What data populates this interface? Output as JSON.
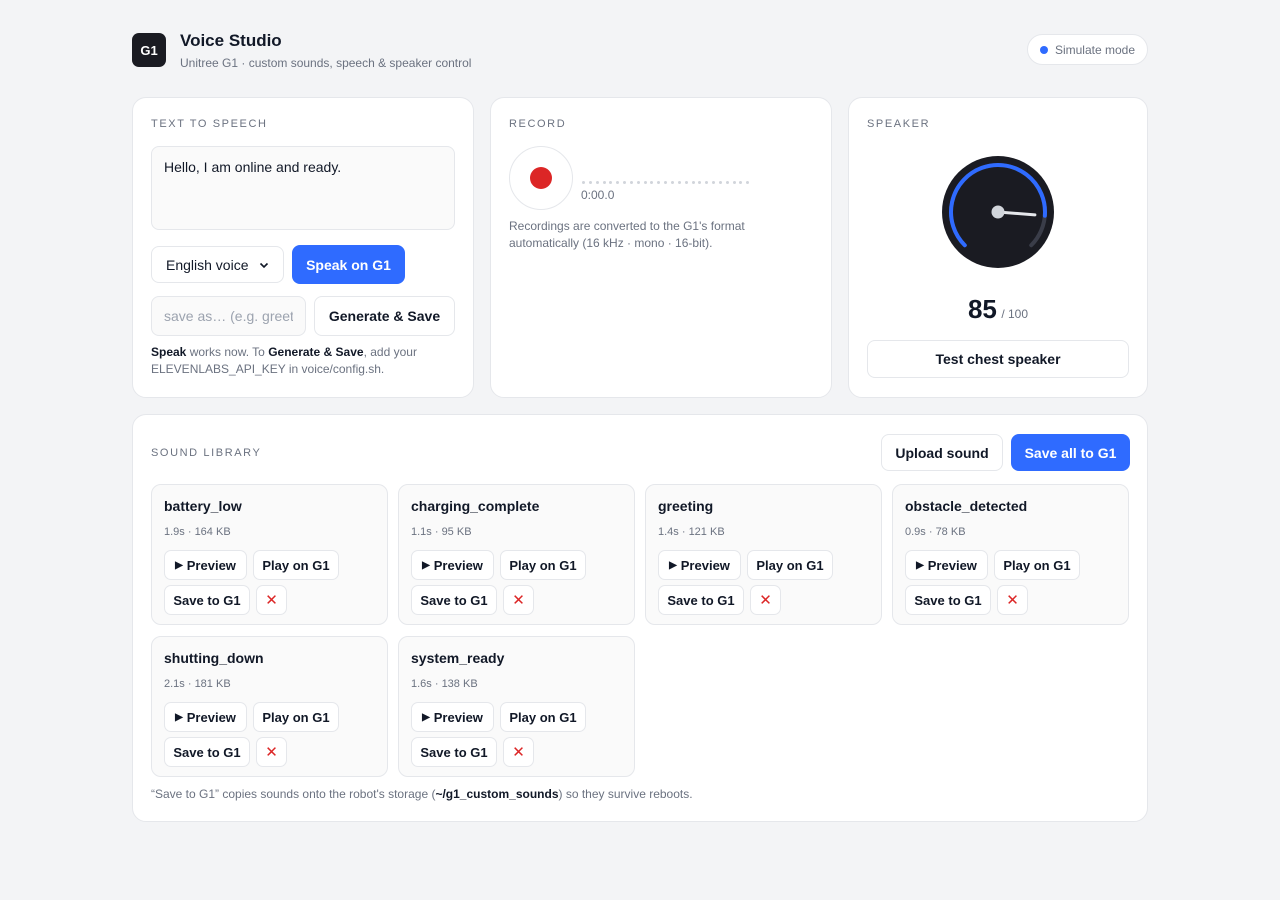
{
  "header": {
    "logo": "G1",
    "title": "Voice Studio",
    "subtitle": "Unitree G1 · custom sounds, speech & speaker control",
    "mode": "Simulate mode"
  },
  "tts": {
    "title": "TEXT TO SPEECH",
    "text": "Hello, I am online and ready.",
    "voice": "English voice",
    "speak_label": "Speak on G1",
    "save_placeholder": "save as… (e.g. greeting)",
    "generate_label": "Generate & Save",
    "note_speak": "Speak",
    "note_1": " works now. To ",
    "note_generate": "Generate & Save",
    "note_2": ", add your ELEVENLABS_API_KEY in voice/config.sh."
  },
  "record": {
    "title": "RECORD",
    "time": "0:00.0",
    "note": "Recordings are converted to the G1's format automatically (16 kHz · mono · 16-bit)."
  },
  "speaker": {
    "title": "SPEAKER",
    "volume": "85",
    "max": "/ 100",
    "level_fraction": 0.85,
    "test_label": "Test chest speaker"
  },
  "library": {
    "title": "SOUND LIBRARY",
    "upload_label": "Upload sound",
    "save_all_label": "Save all to G1",
    "preview_label": "Preview",
    "play_label": "Play on G1",
    "save_label": "Save to G1",
    "delete_glyph": "✕",
    "sounds": [
      {
        "name": "battery_low",
        "meta": "1.9s · 164 KB"
      },
      {
        "name": "charging_complete",
        "meta": "1.1s · 95 KB"
      },
      {
        "name": "greeting",
        "meta": "1.4s · 121 KB"
      },
      {
        "name": "obstacle_detected",
        "meta": "0.9s · 78 KB"
      },
      {
        "name": "shutting_down",
        "meta": "2.1s · 181 KB"
      },
      {
        "name": "system_ready",
        "meta": "1.6s · 138 KB"
      }
    ],
    "note_1": "“Save to G1” copies sounds onto the robot's storage (",
    "note_path": "~/g1_custom_sounds",
    "note_2": ") so they survive reboots."
  },
  "colors": {
    "accent": "#2f6bff",
    "record": "#dc2626",
    "gauge_face": "#1a1b22"
  }
}
